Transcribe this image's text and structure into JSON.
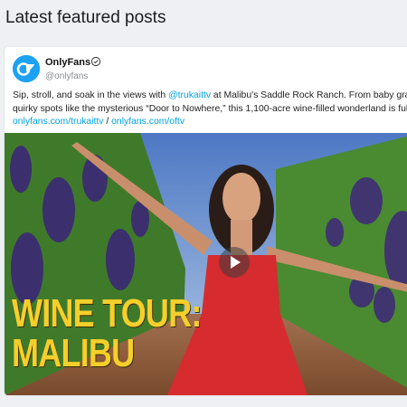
{
  "section": {
    "title": "Latest featured posts"
  },
  "post": {
    "author": {
      "name": "OnlyFans",
      "handle": "@onlyfans",
      "verified": true,
      "avatar_color": "#1da1f2"
    },
    "text": {
      "line1_pre": "Sip, stroll, and soak in the views with ",
      "line1_mention": "@trukaittv",
      "line1_post": " at Malibu's Saddle Rock Ranch. From baby grapes on the",
      "line2": "quirky spots like the mysterious “Door to Nowhere,” this 1,100-acre wine-filled wonderland is full of surpri",
      "link1": "onlyfans.com/trukaittv",
      "link_separator": "/",
      "link2": "onlyfans.com/oftv"
    },
    "media": {
      "type": "video",
      "overlay_title_line1": "WINE TOUR:",
      "overlay_title_line2": "MALIBU",
      "overlay_color": "#f6cf2a",
      "play_icon": "play-icon"
    }
  },
  "colors": {
    "link": "#00a1e6",
    "page_background": "#eef0f3",
    "card_background": "#ffffff"
  }
}
